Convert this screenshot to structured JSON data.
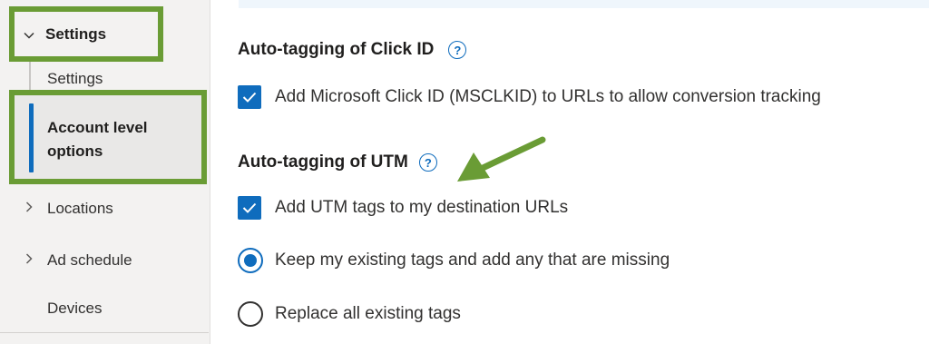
{
  "colors": {
    "accent": "#0f6cbd",
    "annotation": "#6a9c35",
    "sidebar_bg": "#f3f2f1"
  },
  "sidebar": {
    "parent": {
      "label": "Settings",
      "icon": "chevron-down-icon",
      "expanded": true
    },
    "sub_items": [
      {
        "label": "Settings"
      }
    ],
    "selected": {
      "label": "Account level options"
    },
    "items": [
      {
        "label": "Locations",
        "icon": "chevron-right-icon"
      },
      {
        "label": "Ad schedule",
        "icon": "chevron-right-icon"
      },
      {
        "label": "Devices"
      }
    ]
  },
  "main": {
    "click_id": {
      "title": "Auto-tagging of Click ID",
      "help_icon": "help-circle-icon",
      "option": {
        "label": "Add Microsoft Click ID (MSCLKID) to URLs to allow conversion tracking",
        "checked": true
      }
    },
    "utm": {
      "title": "Auto-tagging of UTM",
      "help_icon": "help-circle-icon",
      "option": {
        "label": "Add UTM tags to my destination URLs",
        "checked": true
      },
      "radios": [
        {
          "label": "Keep my existing tags and add any that are missing",
          "selected": true
        },
        {
          "label": "Replace all existing tags",
          "selected": false
        }
      ]
    }
  }
}
